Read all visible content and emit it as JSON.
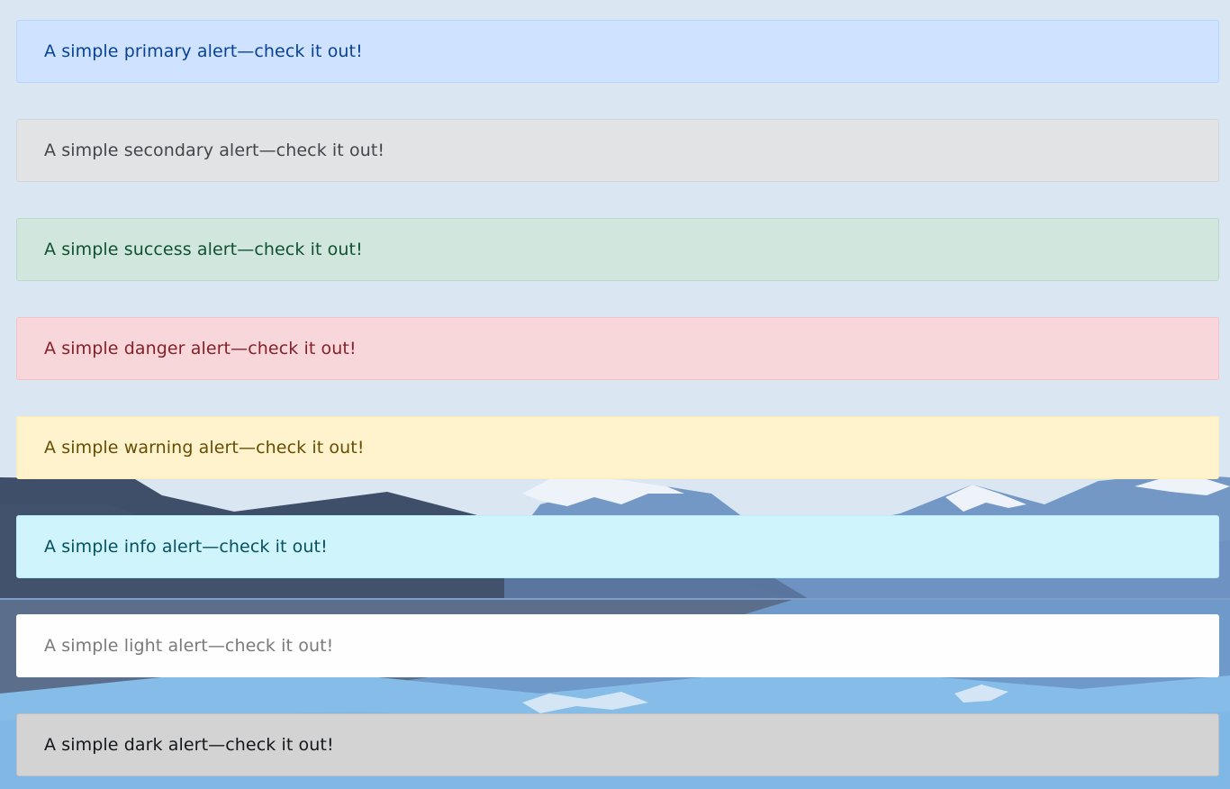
{
  "alerts": [
    {
      "id": "primary",
      "text": "A simple primary alert—check it out!",
      "bg": "#cfe2ff",
      "border": "#b6d4fe",
      "color": "#084298"
    },
    {
      "id": "secondary",
      "text": "A simple secondary alert—check it out!",
      "bg": "#e2e3e5",
      "border": "#d3d6d8",
      "color": "#41464b"
    },
    {
      "id": "success",
      "text": "A simple success alert—check it out!",
      "bg": "#d1e7dd",
      "border": "#badbcc",
      "color": "#0f5132"
    },
    {
      "id": "danger",
      "text": "A simple danger alert—check it out!",
      "bg": "#f8d7da",
      "border": "#f5c2c7",
      "color": "#842029"
    },
    {
      "id": "warning",
      "text": "A simple warning alert—check it out!",
      "bg": "#fff3cd",
      "border": "#ffecb5",
      "color": "#664d03"
    },
    {
      "id": "info",
      "text": "A simple info alert—check it out!",
      "bg": "#cff4fc",
      "border": "#b6effb",
      "color": "#055160"
    },
    {
      "id": "light",
      "text": "A simple light alert—check it out!",
      "bg": "#fefefe",
      "border": "#fdfdfe",
      "color": "#7a7a7a"
    },
    {
      "id": "dark",
      "text": "A simple dark alert—check it out!",
      "bg": "#d3d3d4",
      "border": "#bcbebf",
      "color": "#141619"
    }
  ]
}
